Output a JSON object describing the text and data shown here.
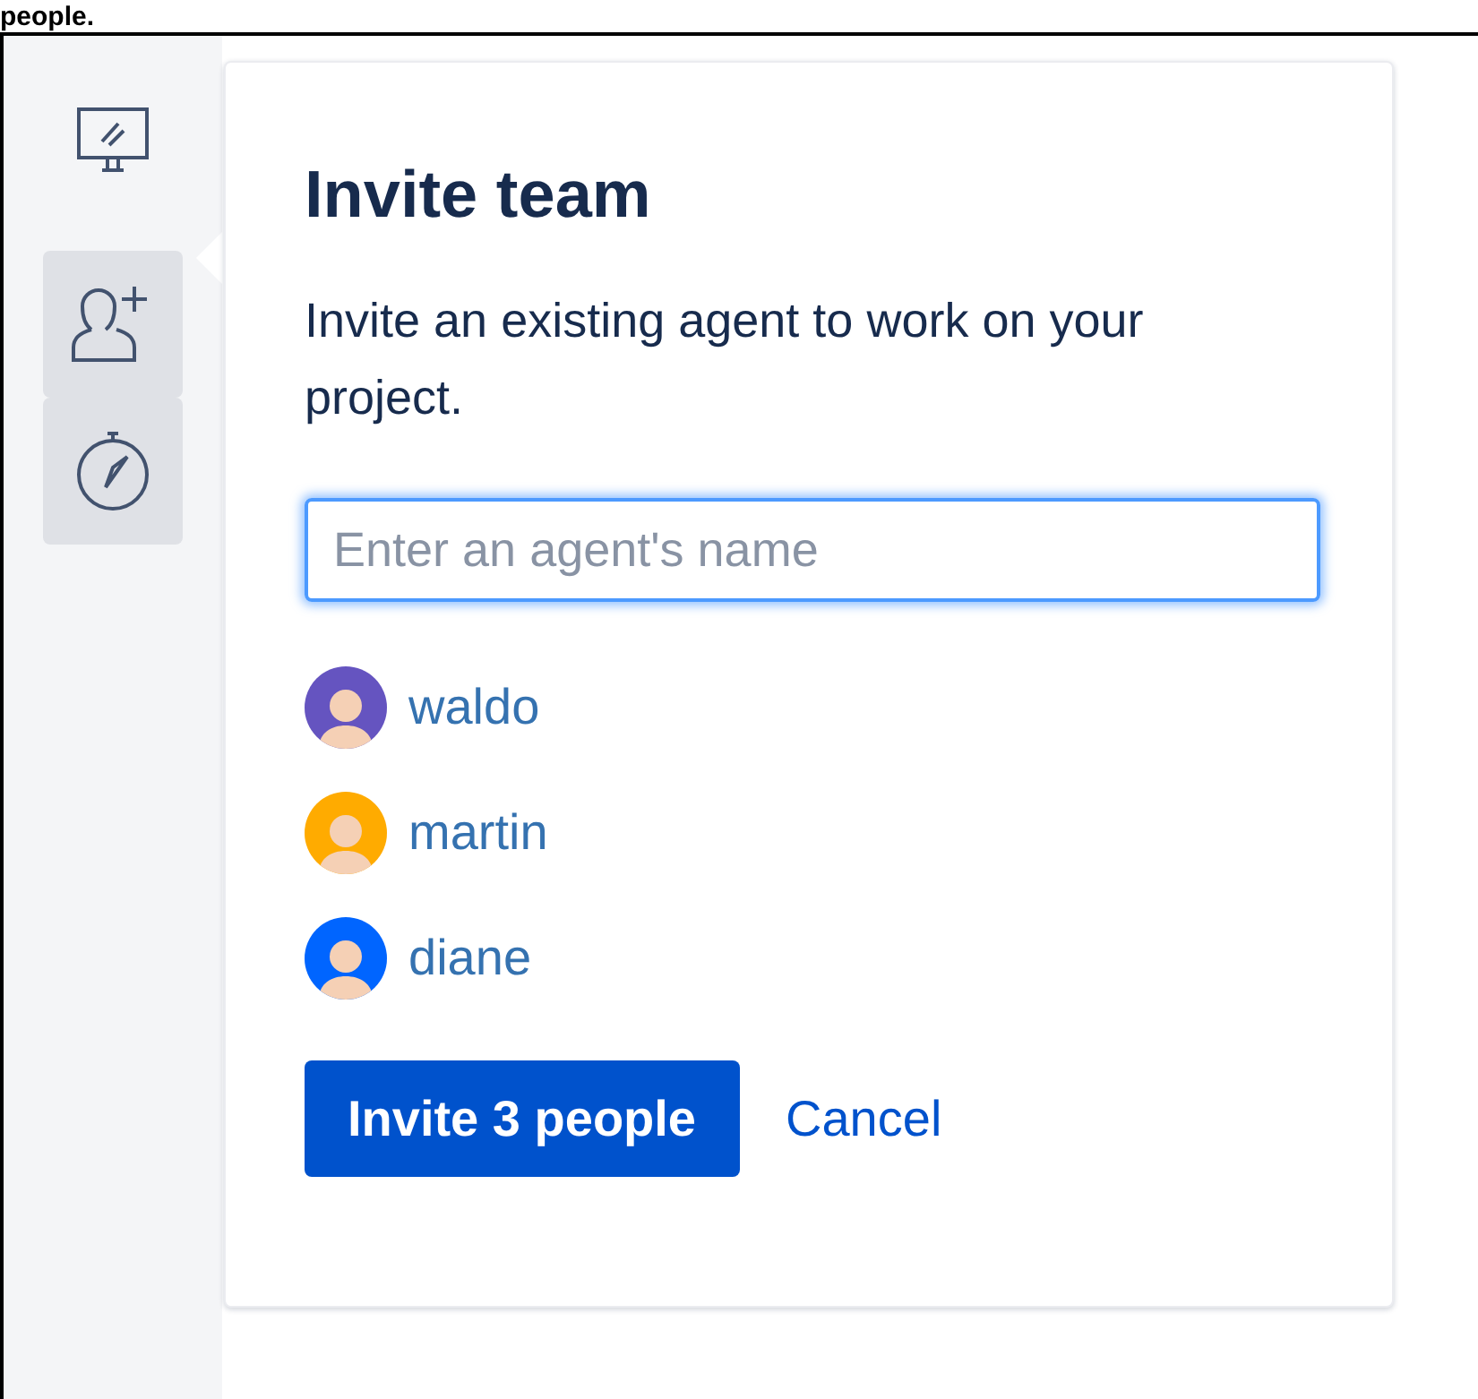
{
  "caption": "people.",
  "sidebar": {
    "items": [
      {
        "kind": "monitor",
        "highlighted": false,
        "selected": false
      },
      {
        "kind": "person-add",
        "highlighted": true,
        "selected": true
      },
      {
        "kind": "compass",
        "highlighted": true,
        "selected": false
      }
    ]
  },
  "popover": {
    "title": "Invite team",
    "description": "Invite an existing agent to work on your project.",
    "search": {
      "placeholder": "Enter an agent's name",
      "focused": true
    },
    "people": [
      {
        "name": "waldo",
        "color": "#6554c0"
      },
      {
        "name": "martin",
        "color": "#ffab00"
      },
      {
        "name": "diane",
        "color": "#0065ff"
      }
    ],
    "primary_button": "Invite 3 people",
    "secondary_button": "Cancel"
  }
}
